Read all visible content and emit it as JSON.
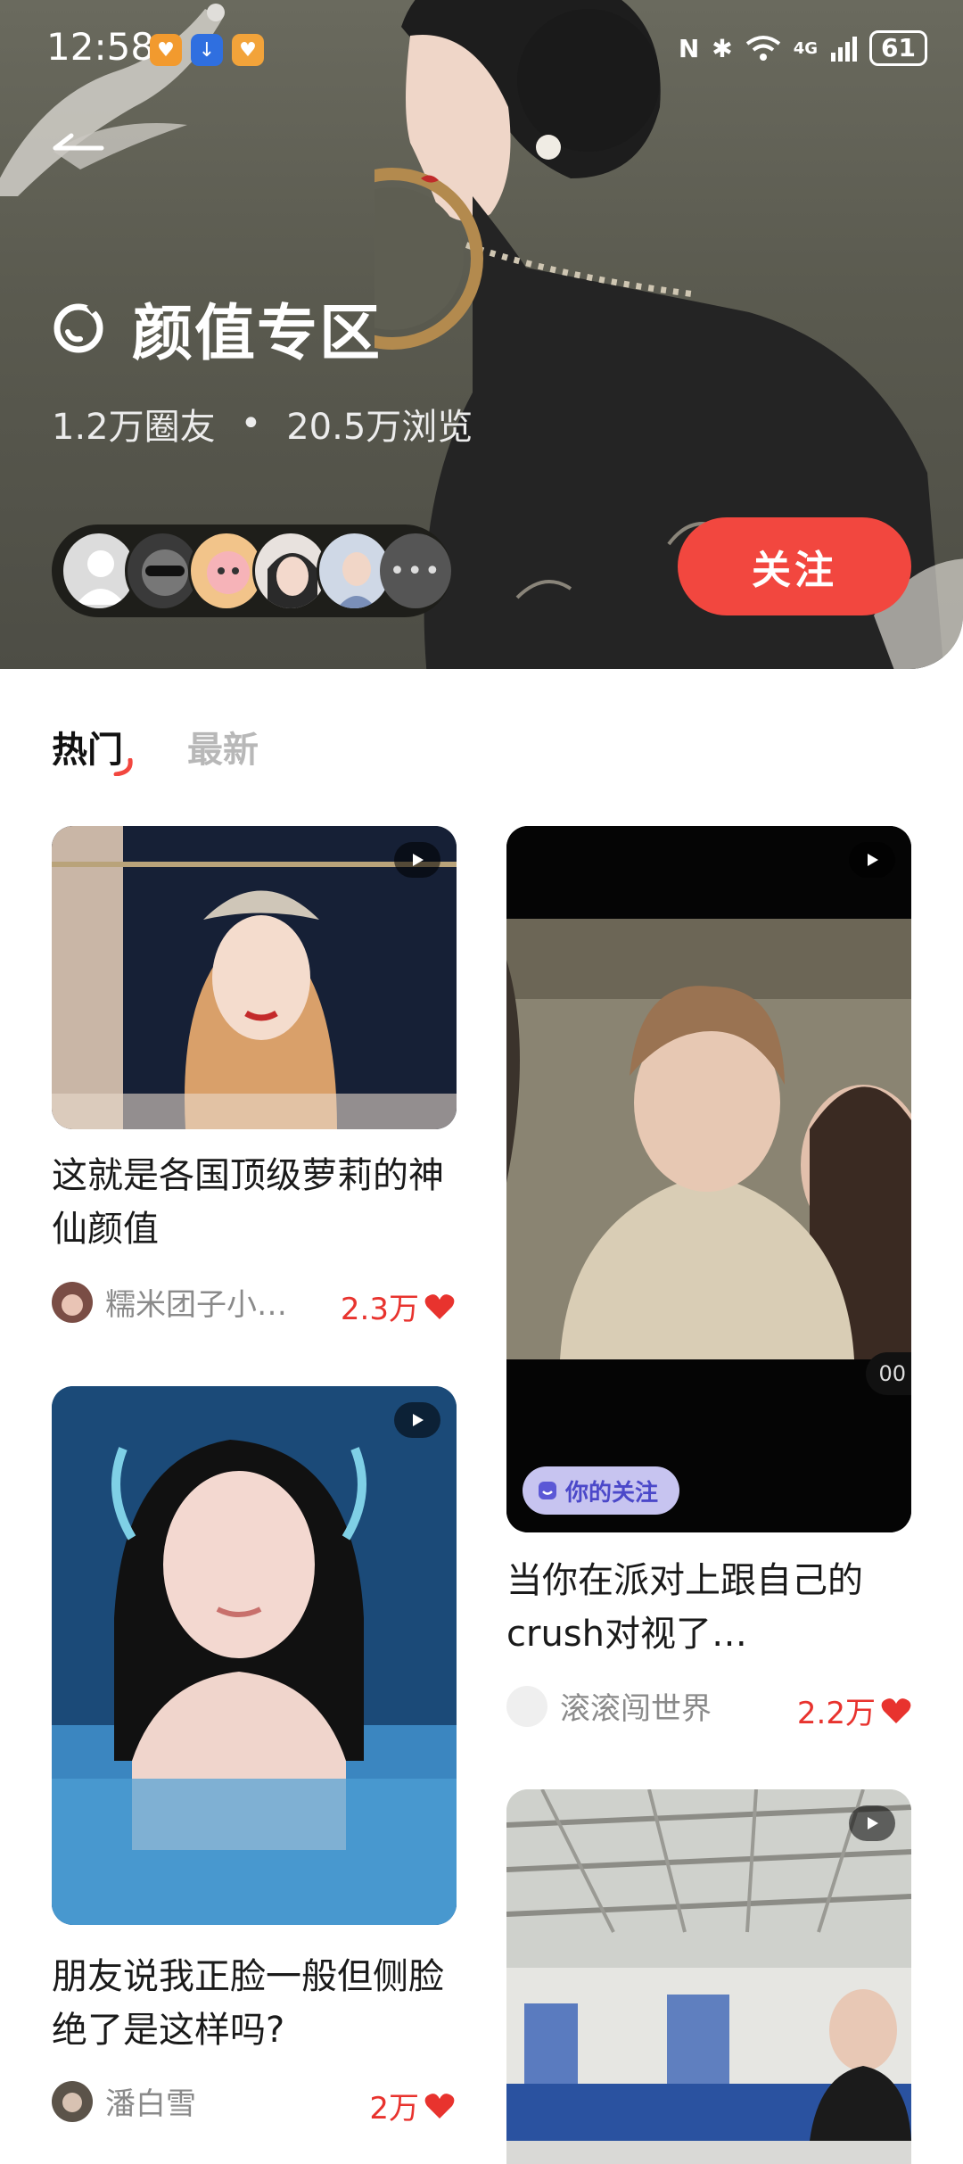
{
  "status_bar": {
    "time": "12:58",
    "battery": "61",
    "network": "4G"
  },
  "header": {
    "title": "颜值专区",
    "members": "1.2万圈友",
    "separator": "•",
    "views": "20.5万浏览",
    "more_label": "•••",
    "follow_label": "关注"
  },
  "tabs": [
    {
      "label": "热门",
      "active": true
    },
    {
      "label": "最新",
      "active": false
    }
  ],
  "posts": [
    {
      "title": "这就是各国顶级萝莉的神仙颜值",
      "author": "糯米团子小…",
      "likes": "2.3万"
    },
    {
      "title": "当你在派对上跟自己的crush对视了…",
      "author": "滚滚闯世界",
      "likes": "2.2万",
      "badge": "你的关注",
      "time_partial": "00"
    },
    {
      "title": "朋友说我正脸一般但侧脸绝了是这样吗?",
      "author": "潘白雪",
      "likes": "2万"
    },
    {
      "title": "",
      "author": "",
      "likes": ""
    }
  ],
  "colors": {
    "accent": "#f2473f",
    "likes": "#e8332e",
    "header_bg": "#5a5a4f"
  }
}
